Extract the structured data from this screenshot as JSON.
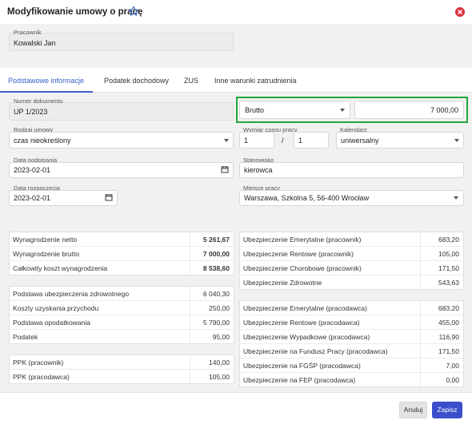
{
  "dialog": {
    "title": "Modyfikowanie umowy o pracę",
    "accent_color": "#3a63c8",
    "close_color": "#d9333f"
  },
  "employee": {
    "label": "Pracownik",
    "value": "Kowalski Jan"
  },
  "tabs": [
    {
      "label": "Podstawowe informacje",
      "active": true
    },
    {
      "label": "Podatek dochodowy",
      "active": false
    },
    {
      "label": "ZUS",
      "active": false
    },
    {
      "label": "Inne warunki zatrudnienia",
      "active": false
    }
  ],
  "form": {
    "document_number": {
      "label": "Numer dokumentu",
      "value": "UP 1/2023"
    },
    "salary_type": {
      "value": "Brutto"
    },
    "salary_amount": {
      "value": "7 000,00"
    },
    "contract_type": {
      "label": "Rodzaj umowy",
      "value": "czas nieokreślony"
    },
    "working_time": {
      "label": "Wymiar czasu pracy",
      "numerator": "1",
      "separator": "/",
      "denominator": "1"
    },
    "calendar": {
      "label": "Kalendarz",
      "value": "uniwersalny"
    },
    "sign_date": {
      "label": "Data podpisania",
      "value": "2023-02-01"
    },
    "position": {
      "label": "Stanowisko",
      "value": "kierowca"
    },
    "start_date": {
      "label": "Data rozpoczęcia",
      "value": "2023-02-01"
    },
    "workplace": {
      "label": "Miejsce pracy",
      "value": "Warszawa, Szkolna 5, 56-400 Wrocław"
    }
  },
  "summary_left": {
    "salary": [
      {
        "label": "Wynagrodzenie netto",
        "value": "5 261,67",
        "bold": true
      },
      {
        "label": "Wynagrodzenie brutto",
        "value": "7 000,00",
        "bold": true
      },
      {
        "label": "Całkowity koszt wynagrodzenia",
        "value": "8 538,60",
        "bold": true
      }
    ],
    "tax": [
      {
        "label": "Podstawa ubezpieczenia zdrowotnego",
        "value": "6 040,30"
      },
      {
        "label": "Koszty uzyskania przychodu",
        "value": "250,00"
      },
      {
        "label": "Podstawa opodatkowania",
        "value": "5 790,00"
      },
      {
        "label": "Podatek",
        "value": "95,00"
      }
    ],
    "ppk": [
      {
        "label": "PPK (pracownik)",
        "value": "140,00"
      },
      {
        "label": "PPK (pracodawca)",
        "value": "105,00"
      }
    ]
  },
  "summary_right": {
    "employee_contrib": [
      {
        "label": "Ubezpieczenie Emerytalne (pracownik)",
        "value": "683,20"
      },
      {
        "label": "Ubezpieczenie Rentowe (pracownik)",
        "value": "105,00"
      },
      {
        "label": "Ubezpieczenie Chorobowe (pracownik)",
        "value": "171,50"
      },
      {
        "label": "Ubezpieczenie Zdrowotne",
        "value": "543,63"
      }
    ],
    "employer_contrib": [
      {
        "label": "Ubezpieczenie Emerytalne (pracodawca)",
        "value": "683,20"
      },
      {
        "label": "Ubezpieczenie Rentowe (pracodawca)",
        "value": "455,00"
      },
      {
        "label": "Ubezpieczenie Wypadkowe (pracodawca)",
        "value": "116,90"
      },
      {
        "label": "Ubezpieczenie na Fundusz Pracy (pracodawca)",
        "value": "171,50"
      },
      {
        "label": "Ubezpieczenie na FGŚP (pracodawca)",
        "value": "7,00"
      },
      {
        "label": "Ubezpieczenie na FEP (pracodawca)",
        "value": "0,00"
      }
    ]
  },
  "footer": {
    "cancel_label": "Anuluj",
    "save_label": "Zapisz",
    "save_color": "#3a4fc9"
  },
  "icons": {
    "star": "star-icon",
    "close": "close-icon",
    "calendar": "calendar-icon",
    "dropdown": "chevron-down-icon"
  }
}
